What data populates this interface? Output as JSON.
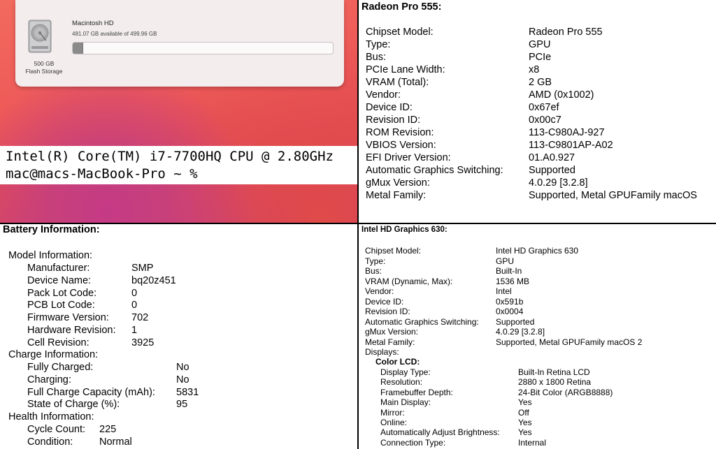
{
  "storage": {
    "capacity": "500 GB",
    "kind": "Flash Storage",
    "volume_name": "Macintosh HD",
    "available": "481.07 GB available of 499.96 GB",
    "used_fraction": 0.038
  },
  "terminal": {
    "line1": "Intel(R) Core(TM) i7-7700HQ CPU @ 2.80GHz",
    "line2": "mac@macs-MacBook-Pro ~ %"
  },
  "radeon": {
    "title": "Radeon Pro 555:",
    "rows": [
      {
        "k": "Chipset Model:",
        "v": "Radeon Pro 555"
      },
      {
        "k": "Type:",
        "v": "GPU"
      },
      {
        "k": "Bus:",
        "v": "PCIe"
      },
      {
        "k": "PCIe Lane Width:",
        "v": "x8"
      },
      {
        "k": "VRAM (Total):",
        "v": "2 GB"
      },
      {
        "k": "Vendor:",
        "v": "AMD (0x1002)"
      },
      {
        "k": "Device ID:",
        "v": "0x67ef"
      },
      {
        "k": "Revision ID:",
        "v": "0x00c7"
      },
      {
        "k": "ROM Revision:",
        "v": "113-C980AJ-927"
      },
      {
        "k": "VBIOS Version:",
        "v": "113-C9801AP-A02"
      },
      {
        "k": "EFI Driver Version:",
        "v": "01.A0.927"
      },
      {
        "k": "Automatic Graphics Switching:",
        "v": "Supported"
      },
      {
        "k": "gMux Version:",
        "v": "4.0.29 [3.2.8]"
      },
      {
        "k": "Metal Family:",
        "v": "Supported, Metal GPUFamily macOS"
      }
    ]
  },
  "battery": {
    "title": "Battery Information:",
    "model_header": "Model Information:",
    "model_rows": [
      {
        "k": "Manufacturer:",
        "v": "SMP"
      },
      {
        "k": "Device Name:",
        "v": "bq20z451"
      },
      {
        "k": "Pack Lot Code:",
        "v": "0"
      },
      {
        "k": "PCB Lot Code:",
        "v": "0"
      },
      {
        "k": "Firmware Version:",
        "v": "702"
      },
      {
        "k": "Hardware Revision:",
        "v": "1"
      },
      {
        "k": "Cell Revision:",
        "v": "3925"
      }
    ],
    "charge_header": "Charge Information:",
    "charge_rows": [
      {
        "k": "Fully Charged:",
        "v": "No"
      },
      {
        "k": "Charging:",
        "v": "No"
      },
      {
        "k": "Full Charge Capacity (mAh):",
        "v": "5831"
      },
      {
        "k": "State of Charge (%):",
        "v": "95"
      }
    ],
    "health_header": "Health Information:",
    "health_rows": [
      {
        "k": "Cycle Count:",
        "v": "225"
      },
      {
        "k": "Condition:",
        "v": "Normal"
      }
    ]
  },
  "intel": {
    "title": "Intel HD Graphics 630:",
    "rows": [
      {
        "k": "Chipset Model:",
        "v": "Intel HD Graphics 630"
      },
      {
        "k": "Type:",
        "v": "GPU"
      },
      {
        "k": "Bus:",
        "v": "Built-In"
      },
      {
        "k": "VRAM (Dynamic, Max):",
        "v": "1536 MB"
      },
      {
        "k": "Vendor:",
        "v": "Intel"
      },
      {
        "k": "Device ID:",
        "v": "0x591b"
      },
      {
        "k": "Revision ID:",
        "v": "0x0004"
      },
      {
        "k": "Automatic Graphics Switching:",
        "v": "Supported"
      },
      {
        "k": "gMux Version:",
        "v": "4.0.29 [3.2.8]"
      },
      {
        "k": "Metal Family:",
        "v": "Supported, Metal GPUFamily macOS 2"
      }
    ],
    "displays_label": "Displays:",
    "display_name": "Color LCD:",
    "display_rows": [
      {
        "k": "Display Type:",
        "v": "Built-In Retina LCD"
      },
      {
        "k": "Resolution:",
        "v": "2880 x 1800 Retina"
      },
      {
        "k": "Framebuffer Depth:",
        "v": "24-Bit Color (ARGB8888)"
      },
      {
        "k": "Main Display:",
        "v": "Yes"
      },
      {
        "k": "Mirror:",
        "v": "Off"
      },
      {
        "k": "Online:",
        "v": "Yes"
      },
      {
        "k": "Automatically Adjust Brightness:",
        "v": "Yes"
      },
      {
        "k": "Connection Type:",
        "v": "Internal"
      }
    ]
  }
}
